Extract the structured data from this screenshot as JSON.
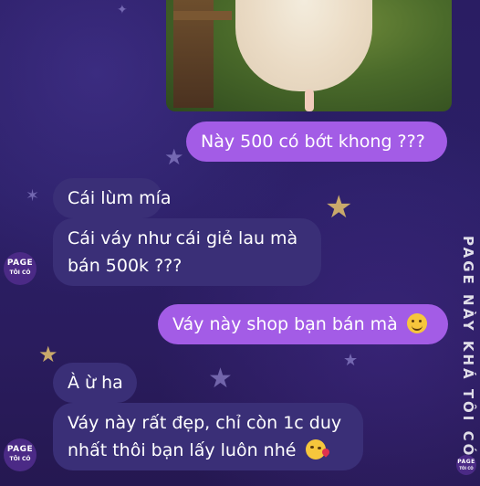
{
  "chat": {
    "messages": [
      {
        "side": "outgoing",
        "text": "Này 500 có bớt khong ???"
      },
      {
        "side": "incoming",
        "text": "Cái lùm mía"
      },
      {
        "side": "incoming",
        "line1": "Cái váy như cái giẻ lau mà",
        "line2": "bán 500k ???"
      },
      {
        "side": "outgoing",
        "text": "Váy này shop bạn bán mà",
        "emoji": "smiling-face"
      },
      {
        "side": "incoming",
        "text": "À ừ ha"
      },
      {
        "side": "incoming",
        "line1": "Váy này rất đẹp, chỉ còn 1c duy",
        "line2": "nhất thôi bạn lấy luôn nhé",
        "emoji": "kissing-face"
      }
    ]
  },
  "avatar": {
    "line1": "PAGE",
    "line2": "TÔI CÓ"
  },
  "watermark": "PAGE NÀY KHÁ TÔI CÓ",
  "colors": {
    "background": "#2a1d63",
    "outgoing_bubble": "#a35ce6",
    "incoming_bubble": "#3a2f77",
    "avatar": "#4b2a86"
  }
}
